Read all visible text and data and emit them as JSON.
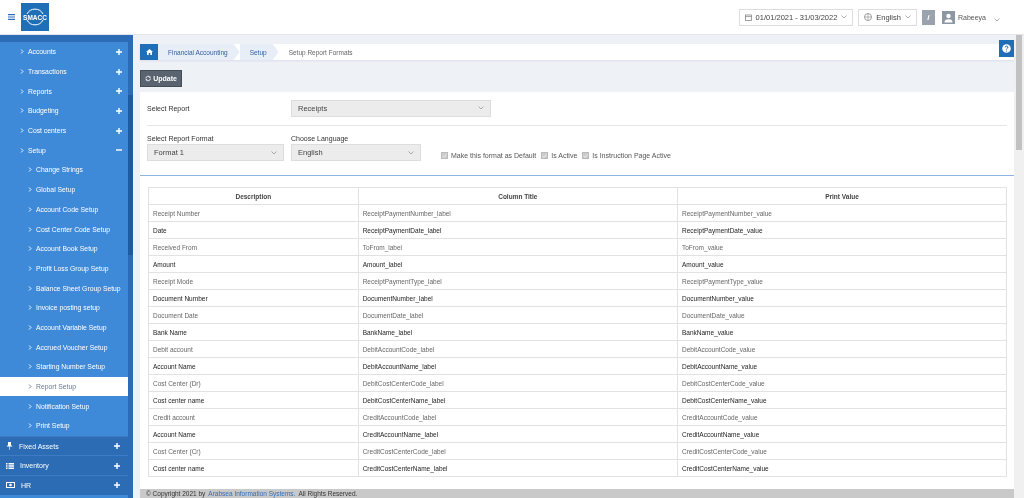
{
  "header": {
    "logo_text": "SMACC",
    "date_range": "01/01/2021 - 31/03/2022",
    "language": "English",
    "info_label": "i",
    "user_name": "Rabeeya"
  },
  "sidebar": {
    "items": [
      {
        "label": "Accounts",
        "expanded": false
      },
      {
        "label": "Transactions",
        "expanded": false
      },
      {
        "label": "Reports",
        "expanded": false
      },
      {
        "label": "Budgeting",
        "expanded": false
      },
      {
        "label": "Cost centers",
        "expanded": false
      },
      {
        "label": "Setup",
        "expanded": true,
        "children": [
          {
            "label": "Change Strings",
            "selected": false
          },
          {
            "label": "Global Setup",
            "selected": false
          },
          {
            "label": "Account Code Setup",
            "selected": false
          },
          {
            "label": "Cost Center Code Setup",
            "selected": false
          },
          {
            "label": "Account Book Setup",
            "selected": false
          },
          {
            "label": "Profit Loss Group Setup",
            "selected": false
          },
          {
            "label": "Balance Sheet Group Setup",
            "selected": false
          },
          {
            "label": "Invoice posting setup",
            "selected": false
          },
          {
            "label": "Account Variable Setup",
            "selected": false
          },
          {
            "label": "Accrued Voucher Setup",
            "selected": false
          },
          {
            "label": "Starting Number Setup",
            "selected": false
          },
          {
            "label": "Report Setup",
            "selected": true
          },
          {
            "label": "Notification Setup",
            "selected": false
          },
          {
            "label": "Print Setup",
            "selected": false
          }
        ]
      }
    ],
    "modules": [
      {
        "label": "Fixed Assets",
        "expanded": false
      },
      {
        "label": "Inventory",
        "expanded": false
      },
      {
        "label": "HR",
        "expanded": false
      }
    ]
  },
  "breadcrumb": [
    "Financial Accounting",
    "Setup",
    "Setup Report Formats"
  ],
  "update_button": "Update",
  "form": {
    "select_report": {
      "label": "Select Report",
      "value": "Receipts"
    },
    "select_format": {
      "label": "Select Report Format",
      "value": "Format 1"
    },
    "choose_language": {
      "label": "Choose Language",
      "value": "English"
    },
    "options": [
      {
        "label": "Make this format as Default",
        "checked": true
      },
      {
        "label": "Is Active",
        "checked": true
      },
      {
        "label": "Is Instruction Page Active",
        "checked": true
      }
    ]
  },
  "table": {
    "columns": [
      "Description",
      "Column Title",
      "Print Value"
    ],
    "rows": [
      [
        "Receipt Number",
        "ReceiptPaymentNumber_label",
        "ReceiptPaymentNumber_value"
      ],
      [
        "Date",
        "ReceiptPaymentDate_label",
        "ReceiptPaymentDate_value"
      ],
      [
        "Received From",
        "ToFrom_label",
        "ToFrom_value"
      ],
      [
        "Amount",
        "Amount_label",
        "Amount_value"
      ],
      [
        "Receipt Mode",
        "ReceiptPaymentType_label",
        "ReceiptPaymentType_value"
      ],
      [
        "Document Number",
        "DocumentNumber_label",
        "DocumentNumber_value"
      ],
      [
        "Document Date",
        "DocumentDate_label",
        "DocumentDate_value"
      ],
      [
        "Bank Name",
        "BankName_label",
        "BankName_value"
      ],
      [
        "Debit account",
        "DebitAccountCode_label",
        "DebitAccountCode_value"
      ],
      [
        "Account Name",
        "DebitAccountName_label",
        "DebitAccountName_value"
      ],
      [
        "Cost Center (Dr)",
        "DebitCostCenterCode_label",
        "DebitCostCenterCode_value"
      ],
      [
        "Cost center name",
        "DebitCostCenterName_label",
        "DebitCostCenterName_value"
      ],
      [
        "Credit account",
        "CreditAccountCode_label",
        "CreditAccountCode_value"
      ],
      [
        "Account Name",
        "CreditAccountName_label",
        "CreditAccountName_value"
      ],
      [
        "Cost Center (Cr)",
        "CreditCostCenterCode_label",
        "CreditCostCenterCode_value"
      ],
      [
        "Cost center name",
        "CreditCostCenterName_label",
        "CreditCostCenterName_value"
      ]
    ]
  },
  "footer": {
    "prefix": "© Copyright 2021 by",
    "link": "Arabsea Information Systems.",
    "suffix": "All Rights Reserved."
  }
}
